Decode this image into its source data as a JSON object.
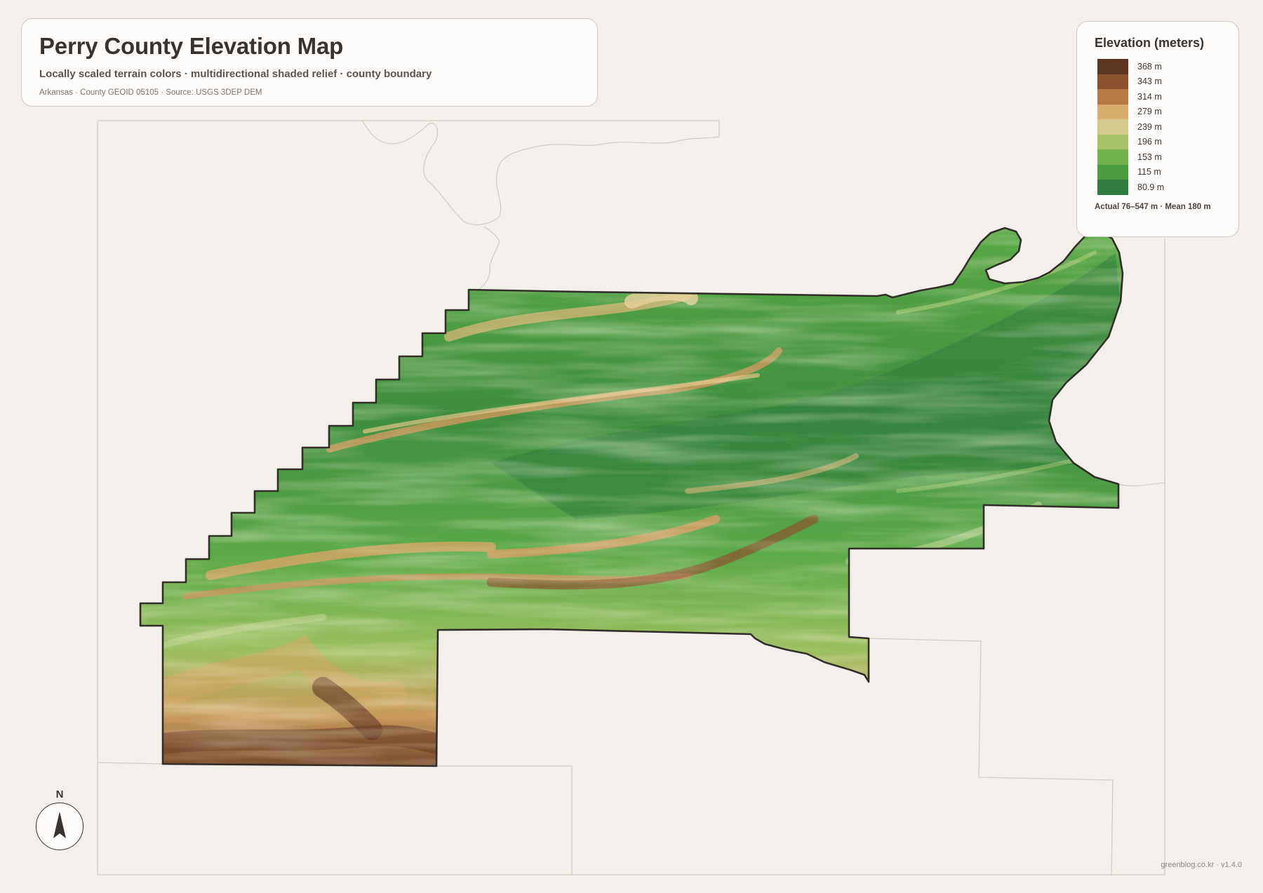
{
  "header": {
    "title": "Perry County Elevation Map",
    "subtitle": "Locally scaled terrain colors · multidirectional shaded relief · county boundary",
    "meta": "Arkansas · County GEOID 05105 · Source: USGS 3DEP DEM"
  },
  "legend": {
    "title": "Elevation (meters)",
    "items": [
      {
        "label": "368 m",
        "color": "#5e3624"
      },
      {
        "label": "343 m",
        "color": "#8c522e"
      },
      {
        "label": "314 m",
        "color": "#b67a42"
      },
      {
        "label": "279 m",
        "color": "#d8ad6c"
      },
      {
        "label": "239 m",
        "color": "#d3c98d"
      },
      {
        "label": "196 m",
        "color": "#a8c267"
      },
      {
        "label": "153 m",
        "color": "#73b24b"
      },
      {
        "label": "115 m",
        "color": "#4a9d3f"
      },
      {
        "label": "80.9 m",
        "color": "#2e7c41"
      }
    ],
    "footer": "Actual 76–547 m · Mean 180 m"
  },
  "north_arrow": {
    "label": "N"
  },
  "footer": {
    "credit": "greenblog.co.kr · v1.4.0"
  },
  "colors": {
    "background": "#f3f0ec",
    "boundary": "#332e29",
    "neighbor_lines": "#cfc9c0",
    "lowland": "#2e7c41",
    "highland": "#5e3624"
  }
}
